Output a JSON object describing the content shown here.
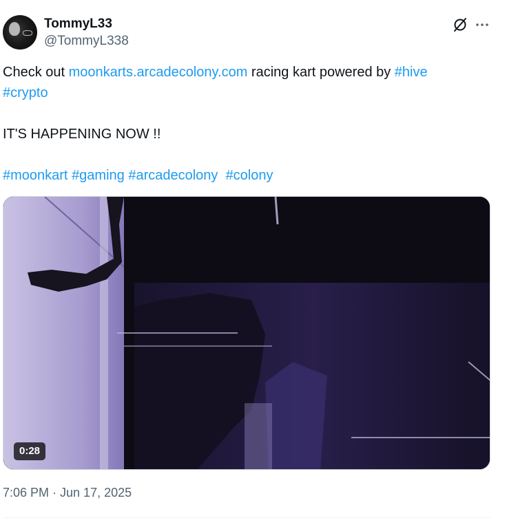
{
  "author": {
    "display_name": "TommyL33",
    "handle": "@TommyL338",
    "avatar_icon": "profile-photo-icon"
  },
  "actions": {
    "grok_icon": "grok-icon",
    "more_icon": "more-icon"
  },
  "tweet": {
    "line1": {
      "prefix": "Check out ",
      "link": "moonkarts.arcadecolony.com",
      "middle": " racing kart powered by ",
      "hashtag": "#hive"
    },
    "line2_hashtag": "#crypto",
    "announcement": "IT'S HAPPENING NOW !!",
    "hashtags": [
      "#moonkart",
      "#gaming",
      "#arcadecolony",
      "#colony"
    ]
  },
  "media": {
    "type": "video",
    "duration": "0:28"
  },
  "timestamp": "7:06 PM · Jun 17, 2025",
  "colors": {
    "link": "#1d9bf0",
    "text": "#0f1419",
    "secondary": "#536471"
  }
}
